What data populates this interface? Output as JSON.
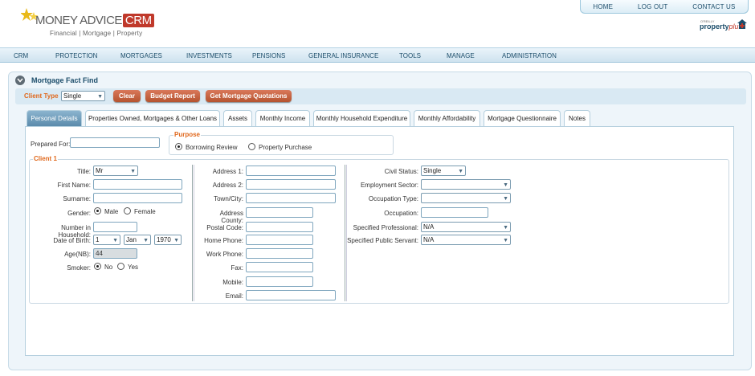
{
  "header": {
    "logo_main": "MONEY ADVICE",
    "logo_crm": "CRM",
    "logo_sub": "Financial | Mortgage | Property",
    "partner_small": "O'REILLY",
    "partner_main": "property",
    "partner_plus": "plus",
    "top_links": [
      "HOME",
      "LOG OUT",
      "CONTACT US"
    ]
  },
  "nav": [
    "CRM",
    "PROTECTION",
    "MORTGAGES",
    "INVESTMENTS",
    "PENSIONS",
    "GENERAL INSURANCE",
    "TOOLS",
    "MANAGE",
    "ADMINISTRATION"
  ],
  "panel": {
    "title": "Mortgage Fact Find"
  },
  "toolbar": {
    "client_type_label": "Client Type",
    "client_type_value": "Single",
    "clear_label": "Clear",
    "budget_label": "Budget Report",
    "quotes_label": "Get Mortgage Quotations"
  },
  "tabs": [
    "Personal Details",
    "Properties Owned, Mortgages & Other Loans",
    "Assets",
    "Monthly Income",
    "Monthly Household Expenditure",
    "Monthly Affordability",
    "Mortgage Questionnaire",
    "Notes"
  ],
  "form": {
    "prepared_for_label": "Prepared For:",
    "prepared_for_value": "",
    "purpose_label": "Purpose",
    "purpose_options": [
      "Borrowing Review",
      "Property Purchase"
    ],
    "client_label": "Client 1",
    "col1": {
      "title_label": "Title:",
      "title_value": "Mr",
      "first_name_label": "First Name:",
      "surname_label": "Surname:",
      "gender_label": "Gender:",
      "gender_options": [
        "Male",
        "Female"
      ],
      "household_label": "Number in Household:",
      "dob_label": "Date of Birth:",
      "dob_day": "1",
      "dob_month": "Jan",
      "dob_year": "1970",
      "age_label": "Age(NB):",
      "age_value": "44",
      "smoker_label": "Smoker:",
      "smoker_options": [
        "No",
        "Yes"
      ]
    },
    "col2": {
      "labels": [
        "Address 1:",
        "Address 2:",
        "Town/City:",
        "Address County:",
        "Postal Code:",
        "Home Phone:",
        "Work Phone:",
        "Fax:",
        "Mobile:",
        "Email:"
      ]
    },
    "col3": {
      "civil_label": "Civil Status:",
      "civil_value": "Single",
      "employment_label": "Employment Sector:",
      "occupation_type_label": "Occupation Type:",
      "occupation_label": "Occupation:",
      "specified_prof_label": "Specified Professional:",
      "specified_prof_value": "N/A",
      "specified_servant_label": "Specified Public Servant:",
      "specified_servant_value": "N/A"
    }
  },
  "colors": {
    "accent_orange": "#e0681c",
    "nav_text": "#1d4e6b",
    "button": "#c0623f",
    "active_tab": "#6f9bba"
  }
}
